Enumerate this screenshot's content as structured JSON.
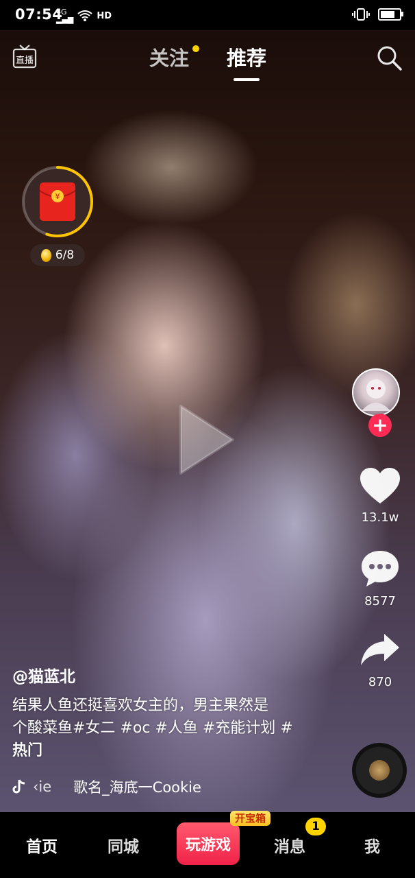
{
  "status_bar": {
    "time": "07:54",
    "signal_text": "4G",
    "network_label": "HD"
  },
  "top_nav": {
    "live_label": "直播",
    "tabs": [
      {
        "label": "关注",
        "active": false,
        "has_dot": true
      },
      {
        "label": "推荐",
        "active": true
      }
    ]
  },
  "reward": {
    "coin_progress": "6/8",
    "ring_progress": 0.55
  },
  "actions": {
    "like_count": "13.1w",
    "comment_count": "8577",
    "share_count": "870"
  },
  "post": {
    "author": "@猫蓝北",
    "caption_line1": "结果人鱼还挺喜欢女主的，男主果然是",
    "caption_line2": "个酸菜鱼#女二 #oc #人鱼 #充能计划 #",
    "caption_line3": "热门",
    "music_prefix": "‹ie",
    "music_title": "歌名_海底一Cookie"
  },
  "bottom_nav": {
    "home": "首页",
    "city": "同城",
    "game": "玩游戏",
    "chest_badge": "开宝箱",
    "messages": "消息",
    "messages_badge": "1",
    "me": "我"
  },
  "colors": {
    "accent_red": "#fe2c55",
    "badge_yellow": "#ffd400"
  }
}
